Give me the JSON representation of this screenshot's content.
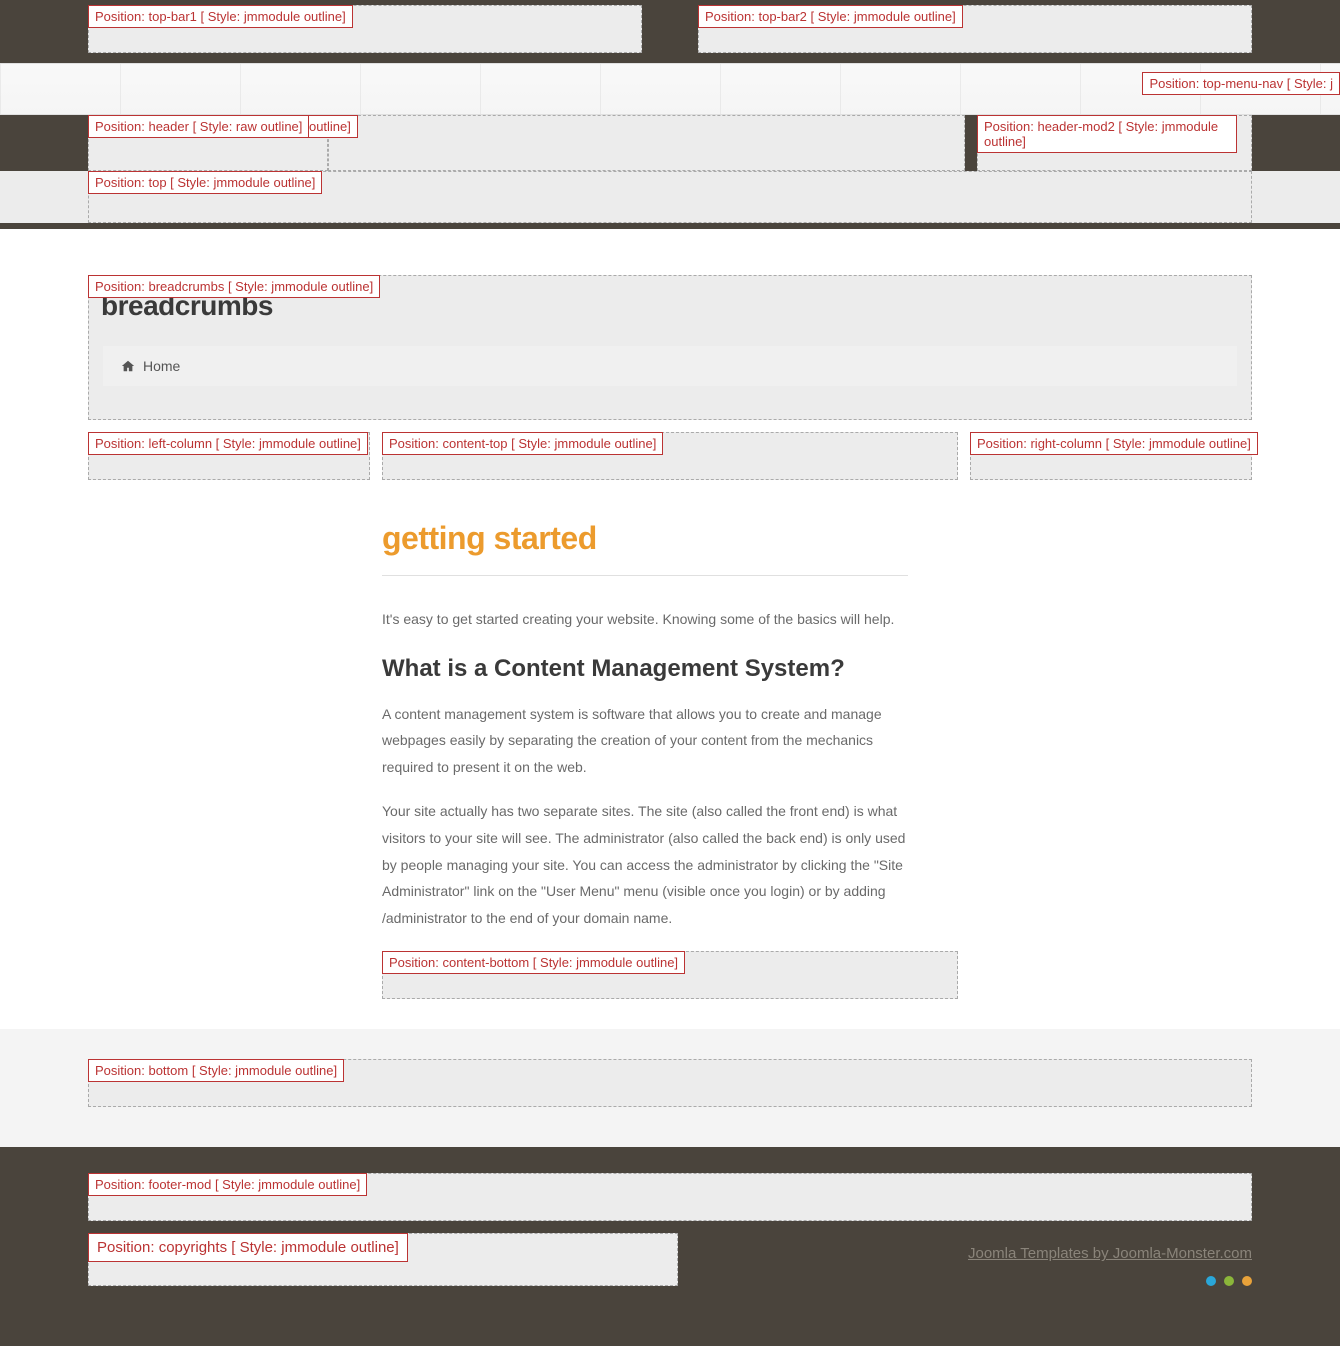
{
  "positions": {
    "top_bar1": "Position: top-bar1 [ Style: jmmodule outline]",
    "top_bar2": "Position: top-bar2 [ Style: jmmodule outline]",
    "top_menu_nav": "Position: top-menu-nav [ Style: j",
    "header": "Position: header [ Style: raw outline]",
    "header_mod1_suffix": "ule outline]",
    "header_mod2": "Position: header-mod2 [ Style: jmmodule outline]",
    "top": "Position: top [ Style: jmmodule outline]",
    "breadcrumbs": "Position: breadcrumbs [ Style: jmmodule outline]",
    "left_column": "Position: left-column [ Style: jmmodule outline]",
    "content_top": "Position: content-top [ Style: jmmodule outline]",
    "right_column": "Position: right-column [ Style: jmmodule outline]",
    "content_bottom": "Position: content-bottom [ Style: jmmodule outline]",
    "bottom": "Position: bottom [ Style: jmmodule outline]",
    "footer_mod": "Position: footer-mod [ Style: jmmodule outline]",
    "copyrights": "Position: copyrights [ Style: jmmodule outline]"
  },
  "breadcrumb": {
    "module_title": "breadcrumbs",
    "home": "Home"
  },
  "article": {
    "title": "getting started",
    "intro": "It's easy to get started creating your website. Knowing some of the basics will help.",
    "h2": "What is a Content Management System?",
    "p1": "A content management system is software that allows you to create and manage webpages easily by separating the creation of your content from the mechanics required to present it on the web.",
    "p2": "Your site actually has two separate sites. The site (also called the front end) is what visitors to your site will see. The administrator (also called the back end) is only used by people managing your site. You can access the administrator by clicking the \"Site Administrator\" link on the \"User Menu\" menu (visible once you login) or by adding /administrator to the end of your domain name."
  },
  "footer": {
    "credit": "Joomla Templates by Joomla-Monster.com"
  },
  "colors": {
    "accent": "#ec9b2d",
    "dark": "#4a443c",
    "label_border": "#b33"
  }
}
